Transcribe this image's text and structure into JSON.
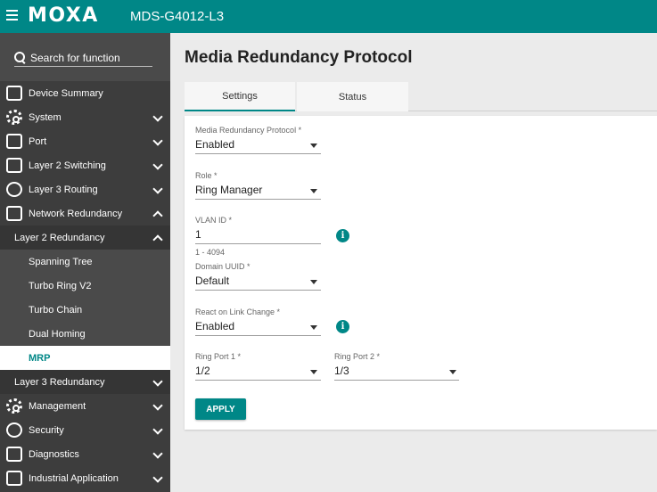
{
  "header": {
    "brand": "MOXA",
    "model": "MDS-G4012-L3"
  },
  "search": {
    "placeholder": "Search for function"
  },
  "sidebar": {
    "items": [
      {
        "label": "Device Summary",
        "icon": "dashboard-icon"
      },
      {
        "label": "System",
        "icon": "gear-icon"
      },
      {
        "label": "Port",
        "icon": "port-icon"
      },
      {
        "label": "Layer 2 Switching",
        "icon": "switch-icon"
      },
      {
        "label": "Layer 3 Routing",
        "icon": "routing-icon"
      },
      {
        "label": "Network Redundancy",
        "icon": "redundancy-icon"
      },
      {
        "label": "Layer 2 Redundancy"
      },
      {
        "label": "Spanning Tree"
      },
      {
        "label": "Turbo Ring V2"
      },
      {
        "label": "Turbo Chain"
      },
      {
        "label": "Dual Homing"
      },
      {
        "label": "MRP"
      },
      {
        "label": "Layer 3 Redundancy"
      },
      {
        "label": "Management",
        "icon": "management-icon"
      },
      {
        "label": "Security",
        "icon": "lock-icon"
      },
      {
        "label": "Diagnostics",
        "icon": "diagnostics-icon"
      },
      {
        "label": "Industrial Application",
        "icon": "application-icon"
      }
    ]
  },
  "page": {
    "title": "Media Redundancy Protocol",
    "tabs": [
      {
        "label": "Settings",
        "active": true
      },
      {
        "label": "Status",
        "active": false
      }
    ]
  },
  "form": {
    "mrp": {
      "label": "Media Redundancy Protocol *",
      "value": "Enabled"
    },
    "role": {
      "label": "Role *",
      "value": "Ring Manager"
    },
    "vlan": {
      "label": "VLAN ID *",
      "value": "1",
      "hint": "1 - 4094"
    },
    "domain": {
      "label": "Domain UUID *",
      "value": "Default"
    },
    "react": {
      "label": "React on Link Change *",
      "value": "Enabled"
    },
    "ring1": {
      "label": "Ring Port 1 *",
      "value": "1/2"
    },
    "ring2": {
      "label": "Ring Port 2 *",
      "value": "1/3"
    },
    "apply_label": "APPLY"
  },
  "colors": {
    "accent": "#008787",
    "sidebar_bg": "#3d3d3d"
  }
}
